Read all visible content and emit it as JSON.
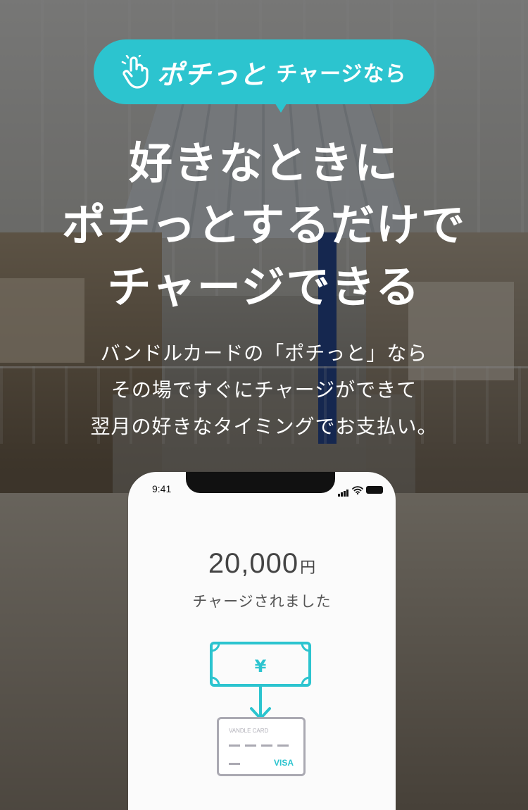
{
  "bubble": {
    "brand": "ポチっと",
    "rest": "チャージなら"
  },
  "headline": {
    "line1": "好きなときに",
    "line2": "ポチっとするだけで",
    "line3": "チャージできる"
  },
  "sub": {
    "line1": "バンドルカードの「ポチっと」なら",
    "line2": "その場ですぐにチャージができて",
    "line3": "翌月の好きなタイミングでお支払い。"
  },
  "phone": {
    "time": "9:41",
    "amount": "20,000",
    "currency": "円",
    "charged": "チャージされました",
    "bill_symbol": "¥",
    "card_brand": "VANDLE CARD",
    "card_network": "VISA"
  },
  "colors": {
    "accent": "#2cc4cf",
    "card_gray": "#aaa9b2"
  },
  "icons": [
    "hand-tap-icon",
    "bill-icon",
    "arrow-down-icon",
    "card-icon",
    "signal-icon",
    "wifi-icon",
    "battery-icon"
  ]
}
